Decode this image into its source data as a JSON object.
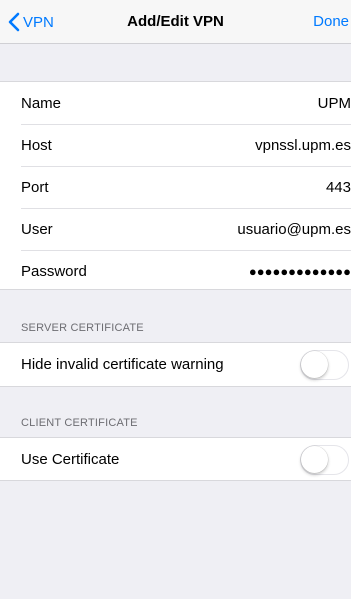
{
  "navbar": {
    "back_label": "VPN",
    "title": "Add/Edit VPN",
    "done_label": "Done"
  },
  "vpn_fields": [
    {
      "label": "Name",
      "value": "UPM"
    },
    {
      "label": "Host",
      "value": "vpnssl.upm.es"
    },
    {
      "label": "Port",
      "value": "443"
    },
    {
      "label": "User",
      "value": "usuario@upm.es"
    },
    {
      "label": "Password",
      "value": "●●●●●●●●●●●●●"
    }
  ],
  "server_certificate": {
    "header": "SERVER CERTIFICATE",
    "label": "Hide invalid certificate warning",
    "enabled": false
  },
  "client_certificate": {
    "header": "CLIENT CERTIFICATE",
    "label": "Use Certificate",
    "enabled": false
  },
  "colors": {
    "accent": "#007aff",
    "background": "#efeff4",
    "section_header": "#6d6d72"
  },
  "icons": {
    "back": "chevron-left-icon"
  }
}
